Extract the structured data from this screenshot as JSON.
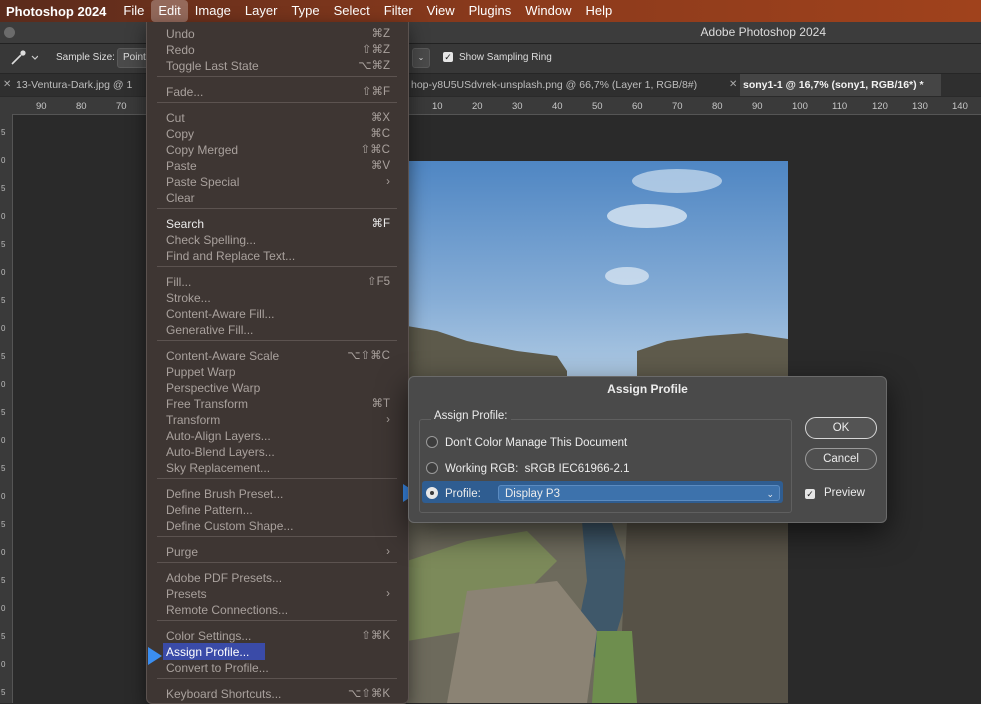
{
  "menubar": {
    "app": "Photoshop 2024",
    "items": [
      "File",
      "Edit",
      "Image",
      "Layer",
      "Type",
      "Select",
      "Filter",
      "View",
      "Plugins",
      "Window",
      "Help"
    ]
  },
  "window": {
    "title": "Adobe Photoshop 2024"
  },
  "options": {
    "sample_size_label": "Sample Size:",
    "sample_size_value": "Point Sample",
    "show_sampling_ring": "Show Sampling Ring"
  },
  "tabs": [
    {
      "label": "13-Ventura-Dark.jpg @ 1"
    },
    {
      "label": "hop-y8U5USdvrek-unsplash.png @ 66,7% (Layer 1, RGB/8#)"
    },
    {
      "label": "sony1-1 @ 16,7% (sony1, RGB/16*) *"
    }
  ],
  "ruler_top": [
    "90",
    "80",
    "70",
    "10",
    "20",
    "30",
    "40",
    "50",
    "60",
    "70",
    "80",
    "90",
    "100",
    "110",
    "120",
    "130",
    "140"
  ],
  "ruler_left": [
    "5",
    "0",
    "5",
    "0",
    "5",
    "0",
    "5",
    "0",
    "5",
    "0",
    "5",
    "0",
    "5",
    "0",
    "5",
    "0",
    "5",
    "0",
    "5",
    "0",
    "5"
  ],
  "edit_menu": {
    "items": [
      {
        "label": "Undo",
        "shortcut": "⌘Z"
      },
      {
        "label": "Redo",
        "shortcut": "⇧⌘Z"
      },
      {
        "label": "Toggle Last State",
        "shortcut": "⌥⌘Z"
      },
      {
        "label": "Fade...",
        "shortcut": "⇧⌘F"
      },
      {
        "label": "Cut",
        "shortcut": "⌘X"
      },
      {
        "label": "Copy",
        "shortcut": "⌘C"
      },
      {
        "label": "Copy Merged",
        "shortcut": "⇧⌘C"
      },
      {
        "label": "Paste",
        "shortcut": "⌘V"
      },
      {
        "label": "Paste Special",
        "shortcut": "›"
      },
      {
        "label": "Clear",
        "shortcut": ""
      },
      {
        "label": "Search",
        "shortcut": "⌘F"
      },
      {
        "label": "Check Spelling...",
        "shortcut": ""
      },
      {
        "label": "Find and Replace Text...",
        "shortcut": ""
      },
      {
        "label": "Fill...",
        "shortcut": "⇧F5"
      },
      {
        "label": "Stroke...",
        "shortcut": ""
      },
      {
        "label": "Content-Aware Fill...",
        "shortcut": ""
      },
      {
        "label": "Generative Fill...",
        "shortcut": ""
      },
      {
        "label": "Content-Aware Scale",
        "shortcut": "⌥⇧⌘C"
      },
      {
        "label": "Puppet Warp",
        "shortcut": ""
      },
      {
        "label": "Perspective Warp",
        "shortcut": ""
      },
      {
        "label": "Free Transform",
        "shortcut": "⌘T"
      },
      {
        "label": "Transform",
        "shortcut": "›"
      },
      {
        "label": "Auto-Align Layers...",
        "shortcut": ""
      },
      {
        "label": "Auto-Blend Layers...",
        "shortcut": ""
      },
      {
        "label": "Sky Replacement...",
        "shortcut": ""
      },
      {
        "label": "Define Brush Preset...",
        "shortcut": ""
      },
      {
        "label": "Define Pattern...",
        "shortcut": ""
      },
      {
        "label": "Define Custom Shape...",
        "shortcut": ""
      },
      {
        "label": "Purge",
        "shortcut": "›"
      },
      {
        "label": "Adobe PDF Presets...",
        "shortcut": ""
      },
      {
        "label": "Presets",
        "shortcut": "›"
      },
      {
        "label": "Remote Connections...",
        "shortcut": ""
      },
      {
        "label": "Color Settings...",
        "shortcut": "⇧⌘K"
      },
      {
        "label": "Assign Profile...",
        "shortcut": ""
      },
      {
        "label": "Convert to Profile...",
        "shortcut": ""
      },
      {
        "label": "Keyboard Shortcuts...",
        "shortcut": "⌥⇧⌘K"
      }
    ]
  },
  "dialog": {
    "title": "Assign Profile",
    "group_label": "Assign Profile:",
    "option_dont": "Don't Color Manage This Document",
    "option_working_label": "Working RGB:",
    "option_working_value": "sRGB IEC61966-2.1",
    "option_profile_label": "Profile:",
    "profile_value": "Display P3",
    "ok": "OK",
    "cancel": "Cancel",
    "preview": "Preview"
  },
  "colors": {
    "accent": "#3b8ef0",
    "menu_highlight": "#3a4ba8",
    "menubar": "#8a3a1c"
  }
}
